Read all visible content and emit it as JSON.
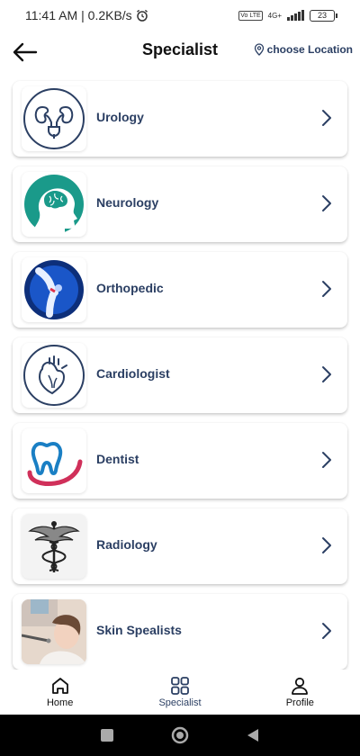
{
  "status_bar": {
    "time": "11:41 AM",
    "network_speed": "| 0.2KB/s",
    "volte": "Vo LTE",
    "network_type": "4G+",
    "battery": "23"
  },
  "header": {
    "title": "Specialist",
    "location_label": "choose Location"
  },
  "specialists": [
    {
      "label": "Urology",
      "icon": "kidney-icon"
    },
    {
      "label": "Neurology",
      "icon": "brain-head-icon"
    },
    {
      "label": "Orthopedic",
      "icon": "knee-joint-icon"
    },
    {
      "label": "Cardiologist",
      "icon": "heart-icon"
    },
    {
      "label": "Dentist",
      "icon": "tooth-icon"
    },
    {
      "label": "Radiology",
      "icon": "caduceus-icon"
    },
    {
      "label": "Skin Spealists",
      "icon": "skin-treatment-photo"
    }
  ],
  "bottom_nav": {
    "home": "Home",
    "specialist": "Specialist",
    "profile": "Profile"
  },
  "colors": {
    "accent": "#2b3f63",
    "teal": "#1a9a8a",
    "dentist_red": "#d0305a"
  }
}
